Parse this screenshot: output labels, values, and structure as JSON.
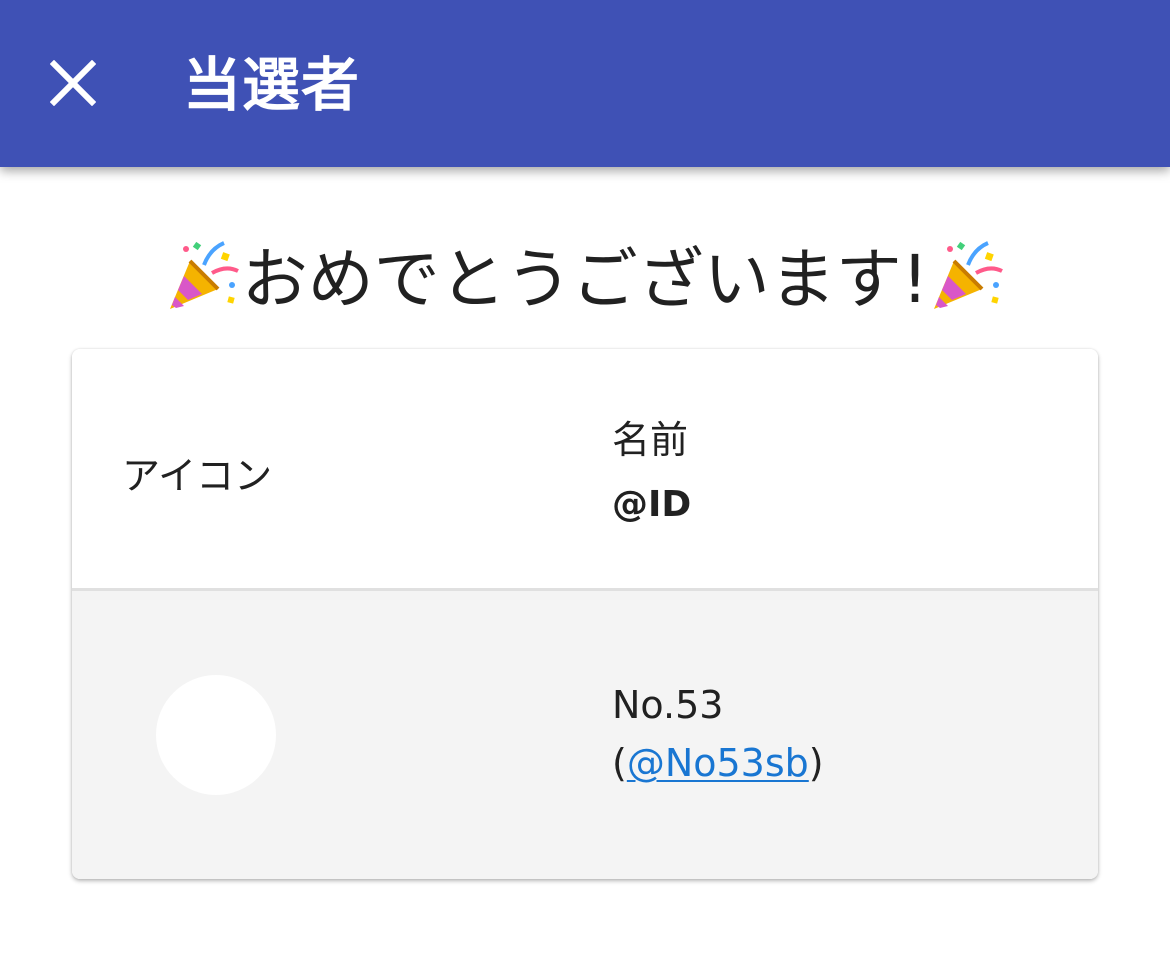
{
  "dialog": {
    "title": "当選者",
    "close_icon": "close-icon",
    "header_color": "#3f51b5"
  },
  "congratulations": {
    "text": "おめでとうございます!",
    "emoji_icon": "party-popper-icon"
  },
  "winners_table": {
    "columns": {
      "icon_label": "アイコン",
      "name_label": "名前",
      "id_label": "@ID"
    },
    "rows": [
      {
        "name": "No.53",
        "paren_open": "(",
        "handle": "@No53sb",
        "paren_close": ")"
      }
    ]
  },
  "colors": {
    "link": "#1976d2",
    "row_background": "#f4f4f4"
  }
}
